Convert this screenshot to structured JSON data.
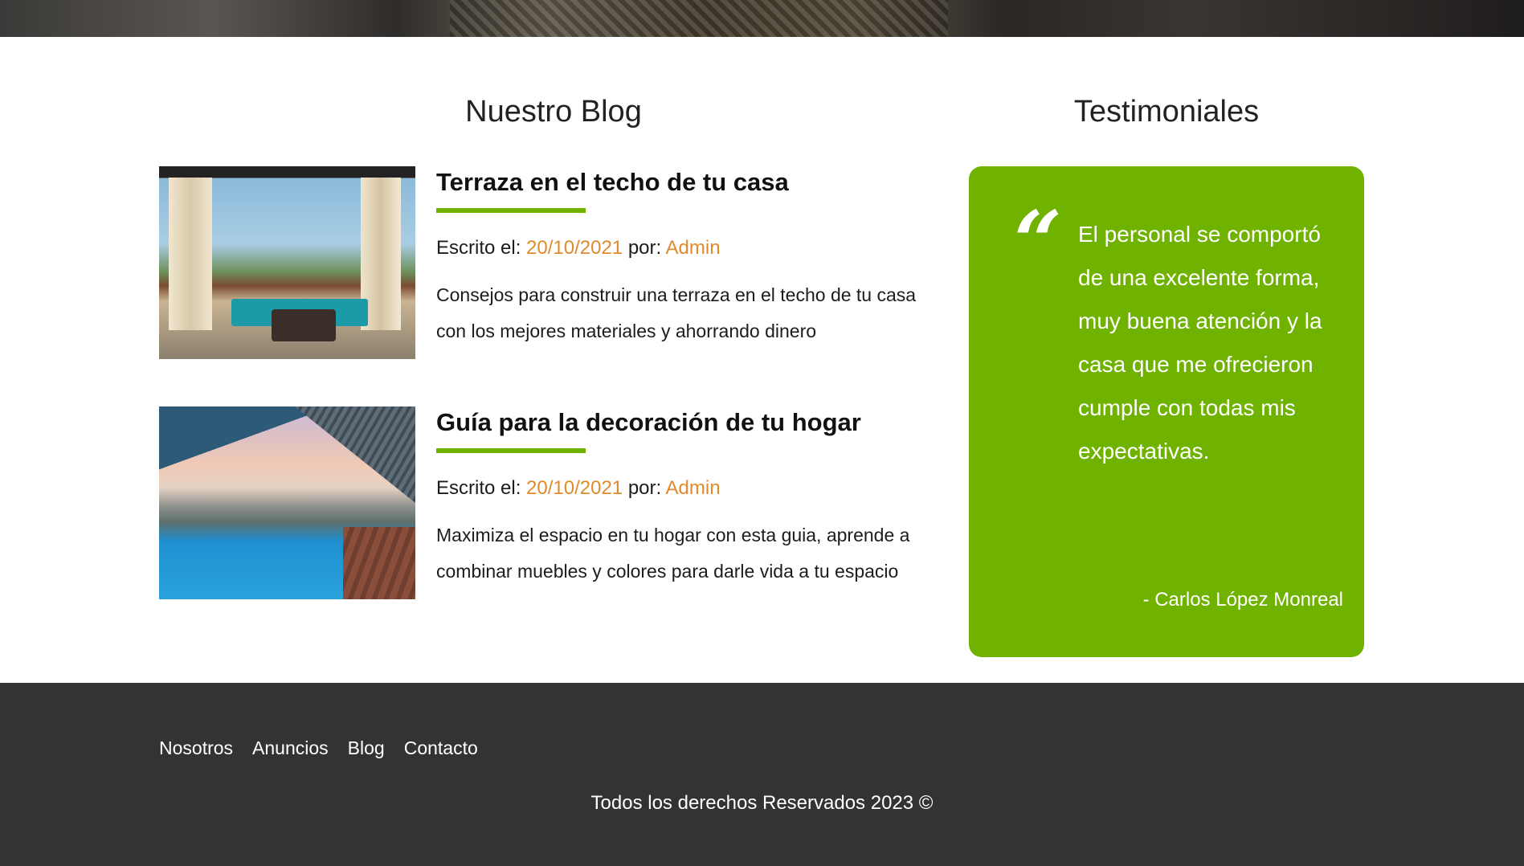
{
  "blog": {
    "title": "Nuestro Blog",
    "posts": [
      {
        "title": "Terraza en el techo de tu casa",
        "meta_prefix": "Escrito el: ",
        "date": "20/10/2021",
        "author_prefix": " por: ",
        "author": "Admin",
        "excerpt": "Consejos para construir una terraza en el techo de tu casa con los mejores materiales y ahorrando dinero"
      },
      {
        "title": "Guía para la decoración de tu hogar",
        "meta_prefix": "Escrito el: ",
        "date": "20/10/2021",
        "author_prefix": " por: ",
        "author": "Admin",
        "excerpt": "Maximiza el espacio en tu hogar con esta guia, aprende a combinar muebles y colores para darle vida a tu espacio"
      }
    ]
  },
  "testimonials": {
    "title": "Testimoniales",
    "quote_mark": "“",
    "quote": "El personal se comportó de una excelente forma, muy buena atención y la casa que me ofrecieron cumple con todas mis expectativas.",
    "author": "- Carlos López Monreal"
  },
  "footer": {
    "nav": [
      "Nosotros",
      "Anuncios",
      "Blog",
      "Contacto"
    ],
    "copyright": "Todos los derechos Reservados 2023 ©"
  },
  "colors": {
    "accent_green": "#70b200",
    "accent_orange": "#e08a2c",
    "footer_bg": "#333333"
  }
}
